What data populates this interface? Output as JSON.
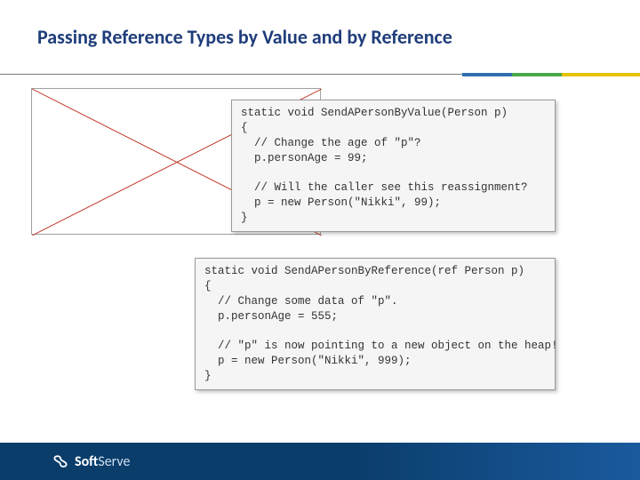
{
  "title": "Passing Reference Types by Value and by Reference",
  "code1": {
    "l1": "static void SendAPersonByValue(Person p)",
    "l2": "{",
    "l3": "  // Change the age of \"p\"?",
    "l4": "  p.personAge = 99;",
    "l5": "",
    "l6": "  // Will the caller see this reassignment?",
    "l7": "  p = new Person(\"Nikki\", 99);",
    "l8": "}"
  },
  "code2": {
    "l1": "static void SendAPersonByReference(ref Person p)",
    "l2": "{",
    "l3": "  // Change some data of \"p\".",
    "l4": "  p.personAge = 555;",
    "l5": "",
    "l6": "  // \"p\" is now pointing to a new object on the heap!",
    "l7": "  p = new Person(\"Nikki\", 999);",
    "l8": "}"
  },
  "footer": {
    "brand_a": "Soft",
    "brand_b": "Serve"
  }
}
